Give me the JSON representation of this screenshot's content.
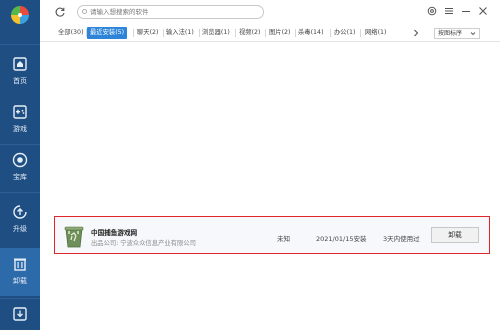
{
  "sidebar": {
    "logo_icon": "pinwheel-logo",
    "items": [
      {
        "label": "首页",
        "icon": "home-icon"
      },
      {
        "label": "游戏",
        "icon": "gamepad-icon"
      },
      {
        "label": "宝库",
        "icon": "treasure-icon"
      },
      {
        "label": "升级",
        "icon": "upgrade-icon"
      },
      {
        "label": "卸载",
        "icon": "trash-icon"
      },
      {
        "label": "",
        "icon": "download-icon"
      }
    ],
    "active_index": 4,
    "colors": {
      "bg": "#1f4e83",
      "active": "#2d6aa9"
    }
  },
  "topbar": {
    "search_placeholder": "请输入想搜索的软件",
    "buttons": [
      "refresh-icon",
      "settings-icon",
      "menu-icon",
      "minimize-icon",
      "maximize-icon",
      "close-icon"
    ]
  },
  "tabs": {
    "items": [
      {
        "label": "全部(30)"
      },
      {
        "label": "最近安装(5)"
      },
      {
        "label": "聊天(2)"
      },
      {
        "label": "输入法(1)"
      },
      {
        "label": "浏览器(1)"
      },
      {
        "label": "视频(2)"
      },
      {
        "label": "图片(2)"
      },
      {
        "label": "杀毒(14)"
      },
      {
        "label": "办公(1)"
      },
      {
        "label": "网络(1)"
      }
    ],
    "active_index": 1,
    "sort_label": "按图标序",
    "accent": "#2d84d8"
  },
  "apps": [
    {
      "name": "中国捕鱼游戏网",
      "publisher": "出品公司: 宁波众众信息产业有限公司",
      "size": "未知",
      "installed": "2021/01/15安装",
      "usage": "3天内使用过",
      "action": "卸载",
      "highlight_color": "#e0262b"
    }
  ]
}
